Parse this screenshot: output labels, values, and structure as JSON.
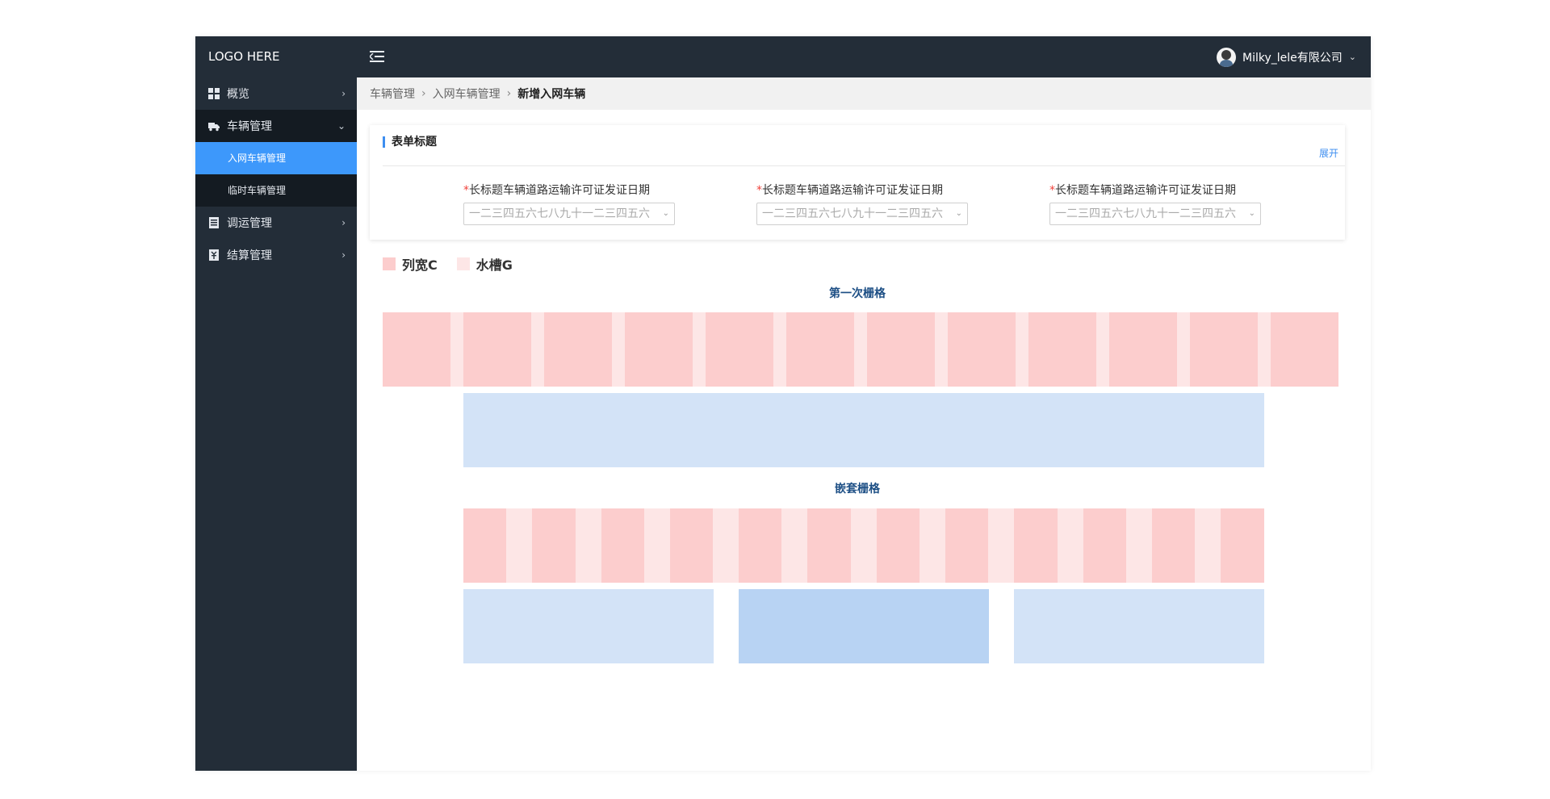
{
  "sidebar": {
    "logo": "LOGO HERE",
    "items": [
      {
        "label": "概览",
        "icon": "dashboard-icon",
        "arrow": "›"
      },
      {
        "label": "车辆管理",
        "icon": "truck-icon",
        "arrow": "⌄",
        "children": [
          {
            "label": "入网车辆管理",
            "active": true
          },
          {
            "label": "临时车辆管理",
            "active": false
          }
        ]
      },
      {
        "label": "调运管理",
        "icon": "document-icon",
        "arrow": "›"
      },
      {
        "label": "结算管理",
        "icon": "receipt-icon",
        "arrow": "›"
      }
    ]
  },
  "header": {
    "menu_toggle_icon": "menu-fold-icon",
    "user_name": "Milky_lele有限公司",
    "user_caret": "⌄"
  },
  "breadcrumb": {
    "items": [
      "车辆管理",
      "入网车辆管理",
      "新增入网车辆"
    ],
    "separator": "›"
  },
  "form_card": {
    "title": "表单标题",
    "expand_label": "展开",
    "fields": [
      {
        "required_mark": "*",
        "label": "长标题车辆道路运输许可证发证日期",
        "placeholder": "一二三四五六七八九十一二三四五六"
      },
      {
        "required_mark": "*",
        "label": "长标题车辆道路运输许可证发证日期",
        "placeholder": "一二三四五六七八九十一二三四五六"
      },
      {
        "required_mark": "*",
        "label": "长标题车辆道路运输许可证发证日期",
        "placeholder": "一二三四五六七八九十一二三四五六"
      }
    ]
  },
  "legend": {
    "items": [
      {
        "label": "列宽C",
        "color": "#fccdcd"
      },
      {
        "label": "水槽G",
        "color": "#fde6e6"
      }
    ]
  },
  "sections": {
    "first_grid_title": "第一次栅格",
    "nested_grid_title": "嵌套栅格"
  },
  "colors": {
    "sidebar_bg": "#232d38",
    "active_blue": "#3d98fb",
    "column_pink": "#fccdcd",
    "gutter_pink": "#fde6e6",
    "light_blue": "#d3e3f7",
    "mid_blue": "#b8d3f3"
  }
}
